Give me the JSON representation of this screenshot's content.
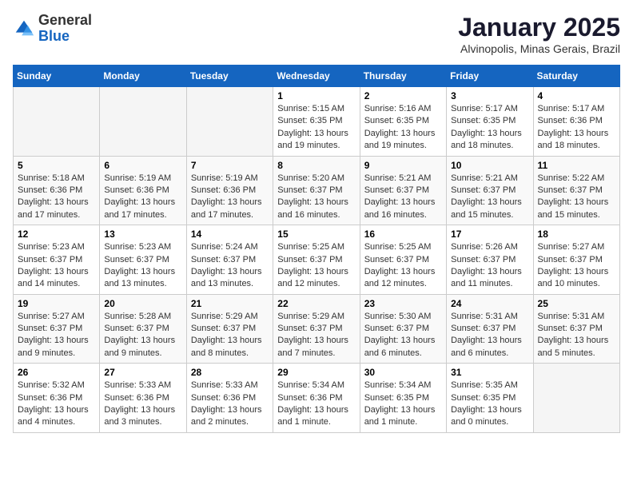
{
  "header": {
    "logo": {
      "general": "General",
      "blue": "Blue"
    },
    "title": "January 2025",
    "subtitle": "Alvinopolis, Minas Gerais, Brazil"
  },
  "weekdays": [
    "Sunday",
    "Monday",
    "Tuesday",
    "Wednesday",
    "Thursday",
    "Friday",
    "Saturday"
  ],
  "weeks": [
    [
      {
        "day": "",
        "info": ""
      },
      {
        "day": "",
        "info": ""
      },
      {
        "day": "",
        "info": ""
      },
      {
        "day": "1",
        "info": "Sunrise: 5:15 AM\nSunset: 6:35 PM\nDaylight: 13 hours\nand 19 minutes."
      },
      {
        "day": "2",
        "info": "Sunrise: 5:16 AM\nSunset: 6:35 PM\nDaylight: 13 hours\nand 19 minutes."
      },
      {
        "day": "3",
        "info": "Sunrise: 5:17 AM\nSunset: 6:35 PM\nDaylight: 13 hours\nand 18 minutes."
      },
      {
        "day": "4",
        "info": "Sunrise: 5:17 AM\nSunset: 6:36 PM\nDaylight: 13 hours\nand 18 minutes."
      }
    ],
    [
      {
        "day": "5",
        "info": "Sunrise: 5:18 AM\nSunset: 6:36 PM\nDaylight: 13 hours\nand 17 minutes."
      },
      {
        "day": "6",
        "info": "Sunrise: 5:19 AM\nSunset: 6:36 PM\nDaylight: 13 hours\nand 17 minutes."
      },
      {
        "day": "7",
        "info": "Sunrise: 5:19 AM\nSunset: 6:36 PM\nDaylight: 13 hours\nand 17 minutes."
      },
      {
        "day": "8",
        "info": "Sunrise: 5:20 AM\nSunset: 6:37 PM\nDaylight: 13 hours\nand 16 minutes."
      },
      {
        "day": "9",
        "info": "Sunrise: 5:21 AM\nSunset: 6:37 PM\nDaylight: 13 hours\nand 16 minutes."
      },
      {
        "day": "10",
        "info": "Sunrise: 5:21 AM\nSunset: 6:37 PM\nDaylight: 13 hours\nand 15 minutes."
      },
      {
        "day": "11",
        "info": "Sunrise: 5:22 AM\nSunset: 6:37 PM\nDaylight: 13 hours\nand 15 minutes."
      }
    ],
    [
      {
        "day": "12",
        "info": "Sunrise: 5:23 AM\nSunset: 6:37 PM\nDaylight: 13 hours\nand 14 minutes."
      },
      {
        "day": "13",
        "info": "Sunrise: 5:23 AM\nSunset: 6:37 PM\nDaylight: 13 hours\nand 13 minutes."
      },
      {
        "day": "14",
        "info": "Sunrise: 5:24 AM\nSunset: 6:37 PM\nDaylight: 13 hours\nand 13 minutes."
      },
      {
        "day": "15",
        "info": "Sunrise: 5:25 AM\nSunset: 6:37 PM\nDaylight: 13 hours\nand 12 minutes."
      },
      {
        "day": "16",
        "info": "Sunrise: 5:25 AM\nSunset: 6:37 PM\nDaylight: 13 hours\nand 12 minutes."
      },
      {
        "day": "17",
        "info": "Sunrise: 5:26 AM\nSunset: 6:37 PM\nDaylight: 13 hours\nand 11 minutes."
      },
      {
        "day": "18",
        "info": "Sunrise: 5:27 AM\nSunset: 6:37 PM\nDaylight: 13 hours\nand 10 minutes."
      }
    ],
    [
      {
        "day": "19",
        "info": "Sunrise: 5:27 AM\nSunset: 6:37 PM\nDaylight: 13 hours\nand 9 minutes."
      },
      {
        "day": "20",
        "info": "Sunrise: 5:28 AM\nSunset: 6:37 PM\nDaylight: 13 hours\nand 9 minutes."
      },
      {
        "day": "21",
        "info": "Sunrise: 5:29 AM\nSunset: 6:37 PM\nDaylight: 13 hours\nand 8 minutes."
      },
      {
        "day": "22",
        "info": "Sunrise: 5:29 AM\nSunset: 6:37 PM\nDaylight: 13 hours\nand 7 minutes."
      },
      {
        "day": "23",
        "info": "Sunrise: 5:30 AM\nSunset: 6:37 PM\nDaylight: 13 hours\nand 6 minutes."
      },
      {
        "day": "24",
        "info": "Sunrise: 5:31 AM\nSunset: 6:37 PM\nDaylight: 13 hours\nand 6 minutes."
      },
      {
        "day": "25",
        "info": "Sunrise: 5:31 AM\nSunset: 6:37 PM\nDaylight: 13 hours\nand 5 minutes."
      }
    ],
    [
      {
        "day": "26",
        "info": "Sunrise: 5:32 AM\nSunset: 6:36 PM\nDaylight: 13 hours\nand 4 minutes."
      },
      {
        "day": "27",
        "info": "Sunrise: 5:33 AM\nSunset: 6:36 PM\nDaylight: 13 hours\nand 3 minutes."
      },
      {
        "day": "28",
        "info": "Sunrise: 5:33 AM\nSunset: 6:36 PM\nDaylight: 13 hours\nand 2 minutes."
      },
      {
        "day": "29",
        "info": "Sunrise: 5:34 AM\nSunset: 6:36 PM\nDaylight: 13 hours\nand 1 minute."
      },
      {
        "day": "30",
        "info": "Sunrise: 5:34 AM\nSunset: 6:35 PM\nDaylight: 13 hours\nand 1 minute."
      },
      {
        "day": "31",
        "info": "Sunrise: 5:35 AM\nSunset: 6:35 PM\nDaylight: 13 hours\nand 0 minutes."
      },
      {
        "day": "",
        "info": ""
      }
    ]
  ]
}
